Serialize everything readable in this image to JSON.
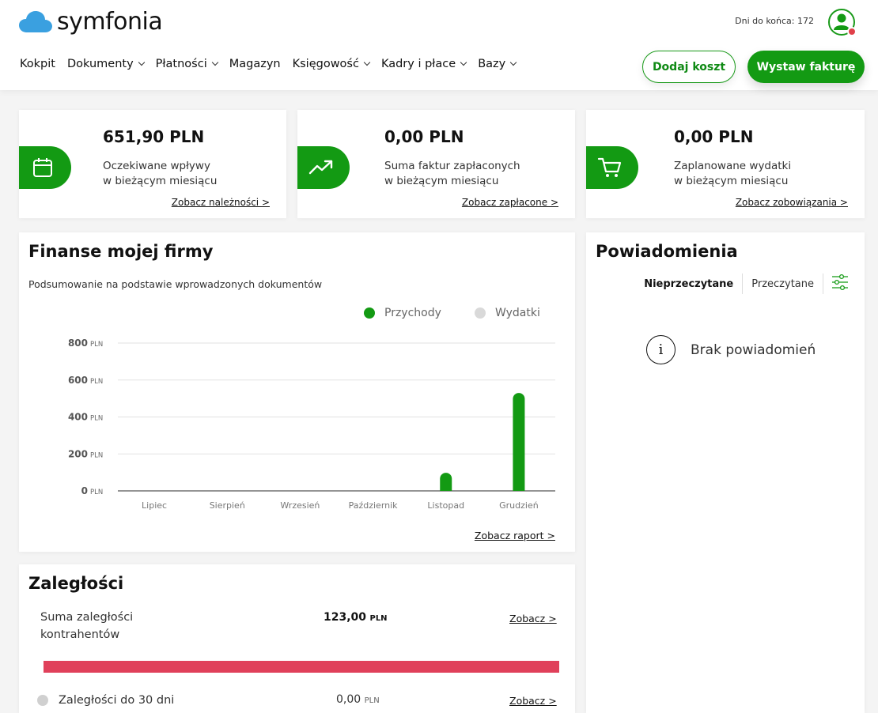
{
  "header": {
    "logo_text": "symfonia",
    "days_left": "Dni do końca: 172",
    "nav": [
      {
        "label": "Kokpit",
        "dropdown": false
      },
      {
        "label": "Dokumenty",
        "dropdown": true
      },
      {
        "label": "Płatności",
        "dropdown": true
      },
      {
        "label": "Magazyn",
        "dropdown": false
      },
      {
        "label": "Księgowość",
        "dropdown": true
      },
      {
        "label": "Kadry i płace",
        "dropdown": true
      },
      {
        "label": "Bazy",
        "dropdown": true
      }
    ],
    "add_cost_label": "Dodaj koszt",
    "issue_invoice_label": "Wystaw fakturę"
  },
  "stats": [
    {
      "value": "651,90 PLN",
      "desc_line1": "Oczekiwane wpływy",
      "desc_line2": "w bieżącym miesiącu",
      "link": "Zobacz należności >",
      "icon": "calendar-icon"
    },
    {
      "value": "0,00 PLN",
      "desc_line1": "Suma faktur zapłaconych",
      "desc_line2": "w bieżącym miesiącu",
      "link": "Zobacz zapłacone >",
      "icon": "trending-up-icon"
    },
    {
      "value": "0,00 PLN",
      "desc_line1": "Zaplanowane wydatki",
      "desc_line2": "w bieżącym miesiącu",
      "link": "Zobacz zobowiązania >",
      "icon": "cart-icon"
    }
  ],
  "finance": {
    "title": "Finanse mojej firmy",
    "subtitle": "Podsumowanie na podstawie wprowadzonych dokumentów",
    "report_link": "Zobacz raport >"
  },
  "chart_data": {
    "type": "bar",
    "categories": [
      "Lipiec",
      "Sierpień",
      "Wrzesień",
      "Październik",
      "Listopad",
      "Grudzień"
    ],
    "series": [
      {
        "name": "Przychody",
        "values": [
          0,
          0,
          0,
          0,
          98,
          530
        ],
        "color": "#139a13"
      },
      {
        "name": "Wydatki",
        "values": [
          0,
          0,
          0,
          0,
          0,
          0
        ],
        "color": "#d9d9d9"
      }
    ],
    "y_ticks": [
      {
        "value": 0,
        "num": "0",
        "unit": "PLN"
      },
      {
        "value": 200,
        "num": "200",
        "unit": "PLN"
      },
      {
        "value": 400,
        "num": "400",
        "unit": "PLN"
      },
      {
        "value": 600,
        "num": "600",
        "unit": "PLN"
      },
      {
        "value": 800,
        "num": "800",
        "unit": "PLN"
      }
    ],
    "ylim": [
      0,
      800
    ],
    "grid": true,
    "legend_position": "top-right"
  },
  "notifications": {
    "title": "Powiadomienia",
    "tab_unread": "Nieprzeczytane",
    "tab_read": "Przeczytane",
    "empty_text": "Brak powiadomień",
    "info_glyph": "i"
  },
  "arrears": {
    "title": "Zaległości",
    "total_label_line1": "Suma zaległości",
    "total_label_line2": "kontrahentów",
    "total_value": "123,00",
    "total_unit": "PLN",
    "total_link": "Zobacz >",
    "bar_color": "#e0405a",
    "row1_label": "Zaległości do 30 dni",
    "row1_value": "0,00",
    "row1_unit": "PLN",
    "row1_link": "Zobacz >"
  }
}
